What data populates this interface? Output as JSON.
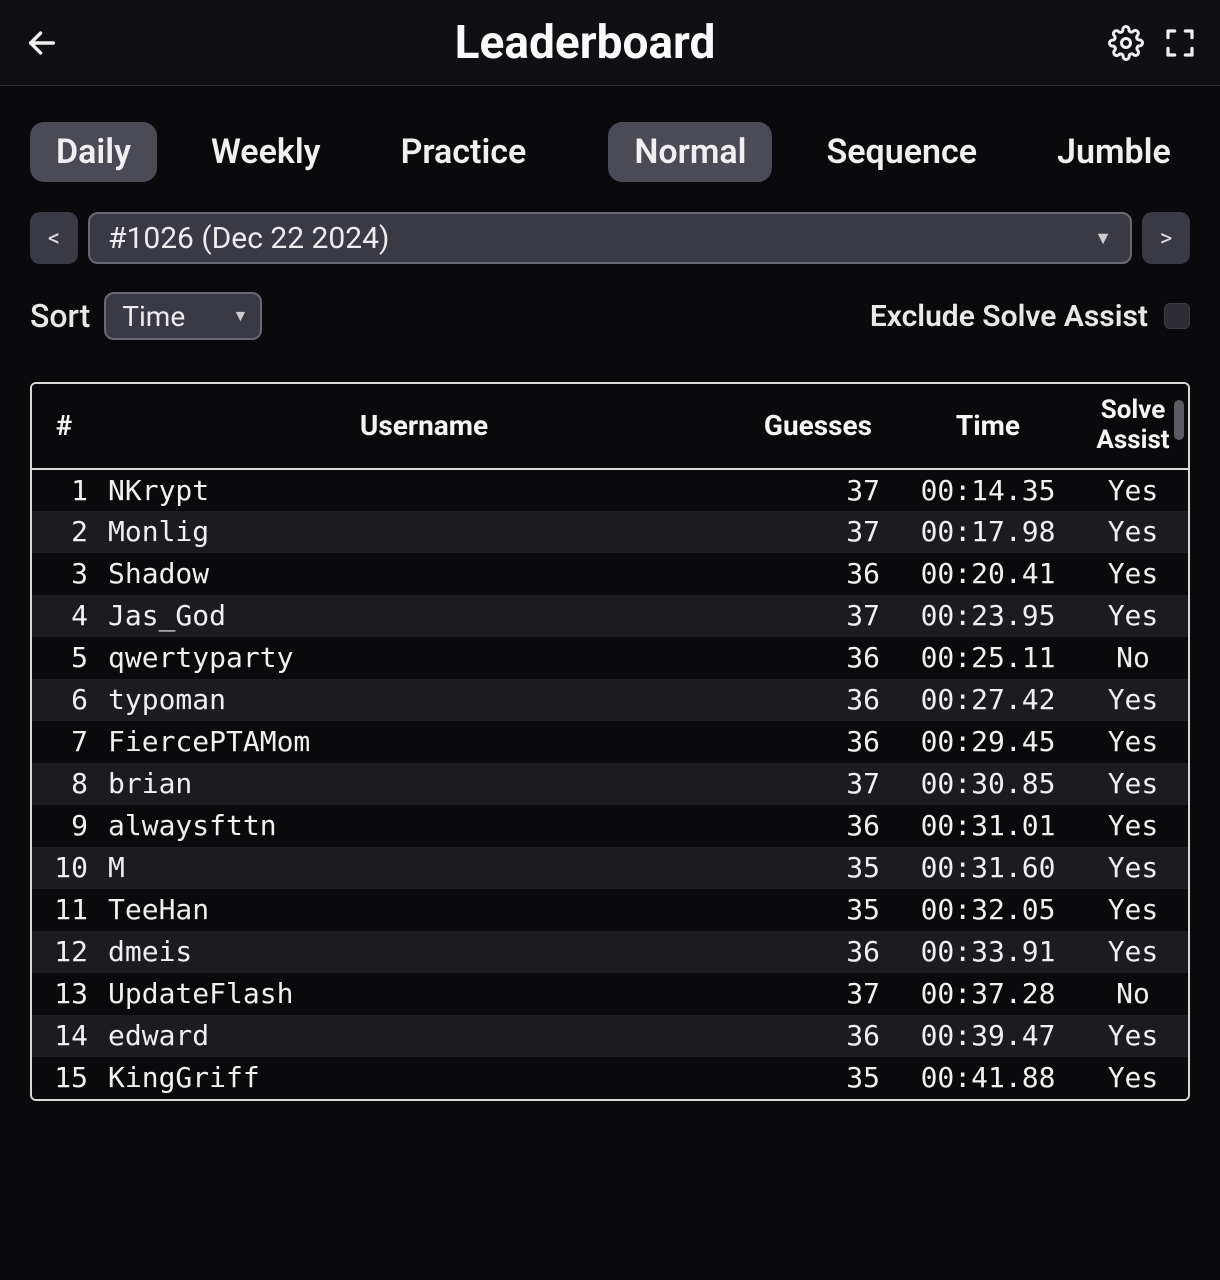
{
  "header": {
    "title": "Leaderboard"
  },
  "tabs_period": [
    {
      "label": "Daily",
      "active": true
    },
    {
      "label": "Weekly",
      "active": false
    },
    {
      "label": "Practice",
      "active": false
    }
  ],
  "tabs_mode": [
    {
      "label": "Normal",
      "active": true
    },
    {
      "label": "Sequence",
      "active": false
    },
    {
      "label": "Jumble",
      "active": false
    }
  ],
  "selector": {
    "prev": "<",
    "next": ">",
    "current": "#1026 (Dec 22 2024)"
  },
  "sort": {
    "label": "Sort",
    "value": "Time"
  },
  "exclude": {
    "label": "Exclude Solve Assist",
    "checked": false
  },
  "table": {
    "columns": {
      "rank": "#",
      "username": "Username",
      "guesses": "Guesses",
      "time": "Time",
      "assist": "Solve Assist"
    },
    "rows": [
      {
        "rank": "1",
        "username": "NKrypt",
        "guesses": "37",
        "time": "00:14.35",
        "assist": "Yes"
      },
      {
        "rank": "2",
        "username": "Monlig",
        "guesses": "37",
        "time": "00:17.98",
        "assist": "Yes"
      },
      {
        "rank": "3",
        "username": "Shadow",
        "guesses": "36",
        "time": "00:20.41",
        "assist": "Yes"
      },
      {
        "rank": "4",
        "username": "Jas_God",
        "guesses": "37",
        "time": "00:23.95",
        "assist": "Yes"
      },
      {
        "rank": "5",
        "username": "qwertyparty",
        "guesses": "36",
        "time": "00:25.11",
        "assist": "No"
      },
      {
        "rank": "6",
        "username": "typoman",
        "guesses": "36",
        "time": "00:27.42",
        "assist": "Yes"
      },
      {
        "rank": "7",
        "username": "FiercePTAMom",
        "guesses": "36",
        "time": "00:29.45",
        "assist": "Yes"
      },
      {
        "rank": "8",
        "username": "brian",
        "guesses": "37",
        "time": "00:30.85",
        "assist": "Yes"
      },
      {
        "rank": "9",
        "username": "alwaysfttn",
        "guesses": "36",
        "time": "00:31.01",
        "assist": "Yes"
      },
      {
        "rank": "10",
        "username": "M",
        "guesses": "35",
        "time": "00:31.60",
        "assist": "Yes"
      },
      {
        "rank": "11",
        "username": "TeeHan",
        "guesses": "35",
        "time": "00:32.05",
        "assist": "Yes"
      },
      {
        "rank": "12",
        "username": "dmeis",
        "guesses": "36",
        "time": "00:33.91",
        "assist": "Yes"
      },
      {
        "rank": "13",
        "username": "UpdateFlash",
        "guesses": "37",
        "time": "00:37.28",
        "assist": "No"
      },
      {
        "rank": "14",
        "username": "edward",
        "guesses": "36",
        "time": "00:39.47",
        "assist": "Yes"
      },
      {
        "rank": "15",
        "username": "KingGriff",
        "guesses": "35",
        "time": "00:41.88",
        "assist": "Yes"
      }
    ]
  }
}
